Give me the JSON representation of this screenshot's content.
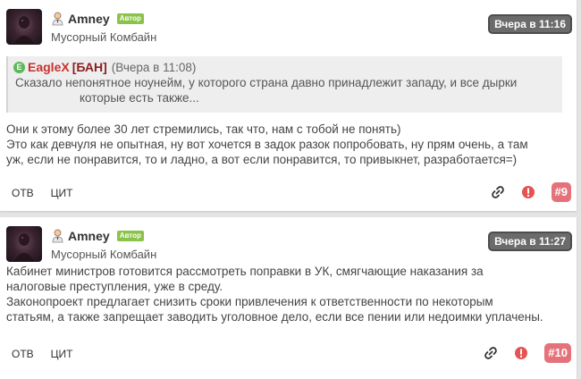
{
  "posts": [
    {
      "username": "Amney",
      "badge": "Автор",
      "rank": "Мусорный Комбайн",
      "time": "Вчера в 11:16",
      "quote": {
        "author": "EagleX",
        "ban": "[БАН]",
        "time": "(Вчера в 11:08)",
        "lines": [
          "Сказало непонятное ноунейм, у которого страна давно принадлежит западу, и все дырки",
          "которые есть также..."
        ]
      },
      "lines": [
        "Они к этому более 30 лет стремились, так что, нам с тобой не понять)",
        "Это как девчуля не опытная, ну вот хочется в задок разок попробовать, ну прям очень, а там",
        "уж, если не понравится, то и ладно, а вот если понравится, то привыкнет, разработается=)"
      ],
      "reply_label": "ОТВ",
      "quote_label": "ЦИТ",
      "number": "#9"
    },
    {
      "username": "Amney",
      "badge": "Автор",
      "rank": "Мусорный Комбайн",
      "time": "Вчера в 11:27",
      "lines": [
        "Кабинет министров готовится рассмотреть поправки в УК, смягчающие наказания за",
        "налоговые преступления, уже в среду.",
        "Законопроект предлагает снизить сроки привлечения к ответственности по некоторым",
        "статьям, а также запрещает заводить уголовное дело, если все пении или недоимки уплачены."
      ],
      "reply_label": "ОТВ",
      "quote_label": "ЦИТ",
      "number": "#10"
    }
  ],
  "icons": {
    "user": "user-icon",
    "quote_author": "e-icon",
    "link": "link-icon",
    "report": "warning-icon"
  },
  "colors": {
    "badge": "#8bc34a",
    "time_bg": "#6b6b6b",
    "number_bg": "#e5727a",
    "report": "#e55353",
    "quote_author": "#c9302c"
  }
}
